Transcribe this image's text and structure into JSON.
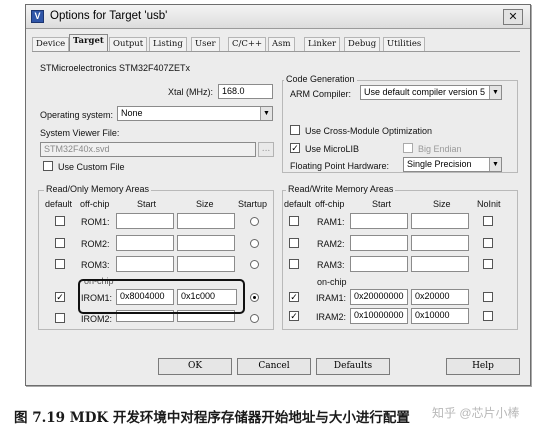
{
  "window": {
    "title": "Options for Target 'usb'",
    "icon_glyph": "V",
    "close_glyph": "✕"
  },
  "tabs": [
    {
      "label": "Device",
      "active": false
    },
    {
      "label": "Target",
      "active": true
    },
    {
      "label": "Output",
      "active": false
    },
    {
      "label": "Listing",
      "active": false
    },
    {
      "label": "User",
      "active": false
    },
    {
      "label": "C/C++",
      "active": false
    },
    {
      "label": "Asm",
      "active": false
    },
    {
      "label": "Linker",
      "active": false
    },
    {
      "label": "Debug",
      "active": false
    },
    {
      "label": "Utilities",
      "active": false
    }
  ],
  "device_name": "STMicroelectronics STM32F407ZETx",
  "xtal": {
    "label": "Xtal (MHz):",
    "value": "168.0"
  },
  "os": {
    "label": "Operating system:",
    "value": "None"
  },
  "svd": {
    "label": "System Viewer File:",
    "value": "STM32F40x.svd",
    "browse": "..."
  },
  "custom_file": {
    "label": "Use Custom File",
    "checked": false
  },
  "codegen": {
    "title": "Code Generation",
    "compiler_label": "ARM Compiler:",
    "compiler_value": "Use default compiler version 5",
    "cross_module": {
      "label": "Use Cross-Module Optimization",
      "checked": false
    },
    "microlib": {
      "label": "Use MicroLIB",
      "checked": true
    },
    "big_endian": {
      "label": "Big Endian",
      "checked": false
    },
    "fp_label": "Floating Point Hardware:",
    "fp_value": "Single Precision"
  },
  "rom": {
    "title": "Read/Only Memory Areas",
    "headers": {
      "default": "default",
      "offchip": "off-chip",
      "start": "Start",
      "size": "Size",
      "startup": "Startup"
    },
    "onchip_label": "on-chip",
    "rows": [
      {
        "name": "ROM1:",
        "start": "",
        "size": "",
        "default": false,
        "startup": false
      },
      {
        "name": "ROM2:",
        "start": "",
        "size": "",
        "default": false,
        "startup": false
      },
      {
        "name": "ROM3:",
        "start": "",
        "size": "",
        "default": false,
        "startup": false
      },
      {
        "name": "IROM1:",
        "start": "0x8004000",
        "size": "0x1c000",
        "default": true,
        "startup": true
      },
      {
        "name": "IROM2:",
        "start": "",
        "size": "",
        "default": false,
        "startup": false
      }
    ]
  },
  "ram": {
    "title": "Read/Write Memory Areas",
    "headers": {
      "default": "default",
      "offchip": "off-chip",
      "start": "Start",
      "size": "Size",
      "noinit": "NoInit"
    },
    "onchip_label": "on-chip",
    "rows": [
      {
        "name": "RAM1:",
        "start": "",
        "size": "",
        "default": false,
        "noinit": false
      },
      {
        "name": "RAM2:",
        "start": "",
        "size": "",
        "default": false,
        "noinit": false
      },
      {
        "name": "RAM3:",
        "start": "",
        "size": "",
        "default": false,
        "noinit": false
      },
      {
        "name": "IRAM1:",
        "start": "0x20000000",
        "size": "0x20000",
        "default": true,
        "noinit": false
      },
      {
        "name": "IRAM2:",
        "start": "0x10000000",
        "size": "0x10000",
        "default": true,
        "noinit": false
      }
    ]
  },
  "buttons": {
    "ok": "OK",
    "cancel": "Cancel",
    "defaults": "Defaults",
    "help": "Help"
  },
  "caption": "图 7.19   MDK 开发环境中对程序存储器开始地址与大小进行配置",
  "watermark": "知乎 @芯片小棒",
  "colors": {
    "accent": "#2f55a8",
    "dialog_bg": "#ececec",
    "border": "#8b8b8b"
  }
}
